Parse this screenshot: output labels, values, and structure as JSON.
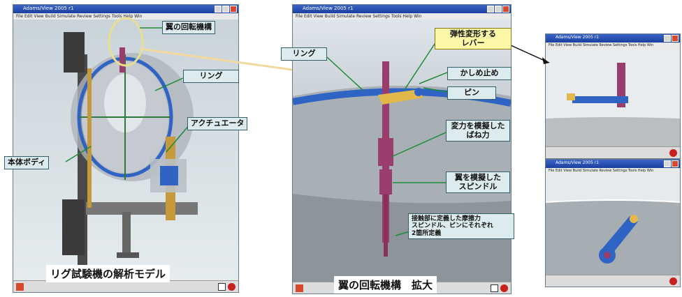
{
  "windows": {
    "left": {
      "title": "Adams/View 2005 r1",
      "menu": "File  Edit  View  Build  Simulate  Review  Settings  Tools  Help  Win"
    },
    "center": {
      "title": "Adams/View 2005 r1",
      "menu": "File  Edit  View  Build  Simulate  Review  Settings  Tools  Help  Win"
    },
    "right_top": {
      "title": "Adams/View 2005 r1",
      "menu": "File  Edit  View  Build  Simulate  Review  Settings  Tools  Help  Win"
    },
    "right_bottom": {
      "title": "Adams/View 2005 r1",
      "menu": "File  Edit  View  Build  Simulate  Review  Settings  Tools  Help  Win"
    }
  },
  "left_labels": {
    "rotation_mechanism": "翼の回転機構",
    "ring": "リング",
    "actuator": "アクチュエータ",
    "body": "本体ボディ"
  },
  "center_labels": {
    "ring": "リング",
    "lever": [
      "弾性変形する",
      "レバー"
    ],
    "caulking_stop": "かしめ止め",
    "pin": "ピン",
    "spring_force": [
      "変力を模擬した",
      "ばね力"
    ],
    "spindle": [
      "翼を模擬した",
      "スピンドル"
    ],
    "friction": [
      "接触部に定義した摩擦力",
      "スピンドル、ピンにそれぞれ",
      "2箇所定義"
    ]
  },
  "captions": {
    "left": "リグ試験機の解析モデル",
    "center": "翼の回転機構　拡大"
  },
  "colors": {
    "label_bg": "#dcebee",
    "label_border": "#355f68",
    "highlight_bg": "#fbf7a6",
    "spindle": "#9b3d6c",
    "ring": "#2f63c4",
    "lever": "#e2b84a",
    "leader": "#1d8a3a"
  }
}
